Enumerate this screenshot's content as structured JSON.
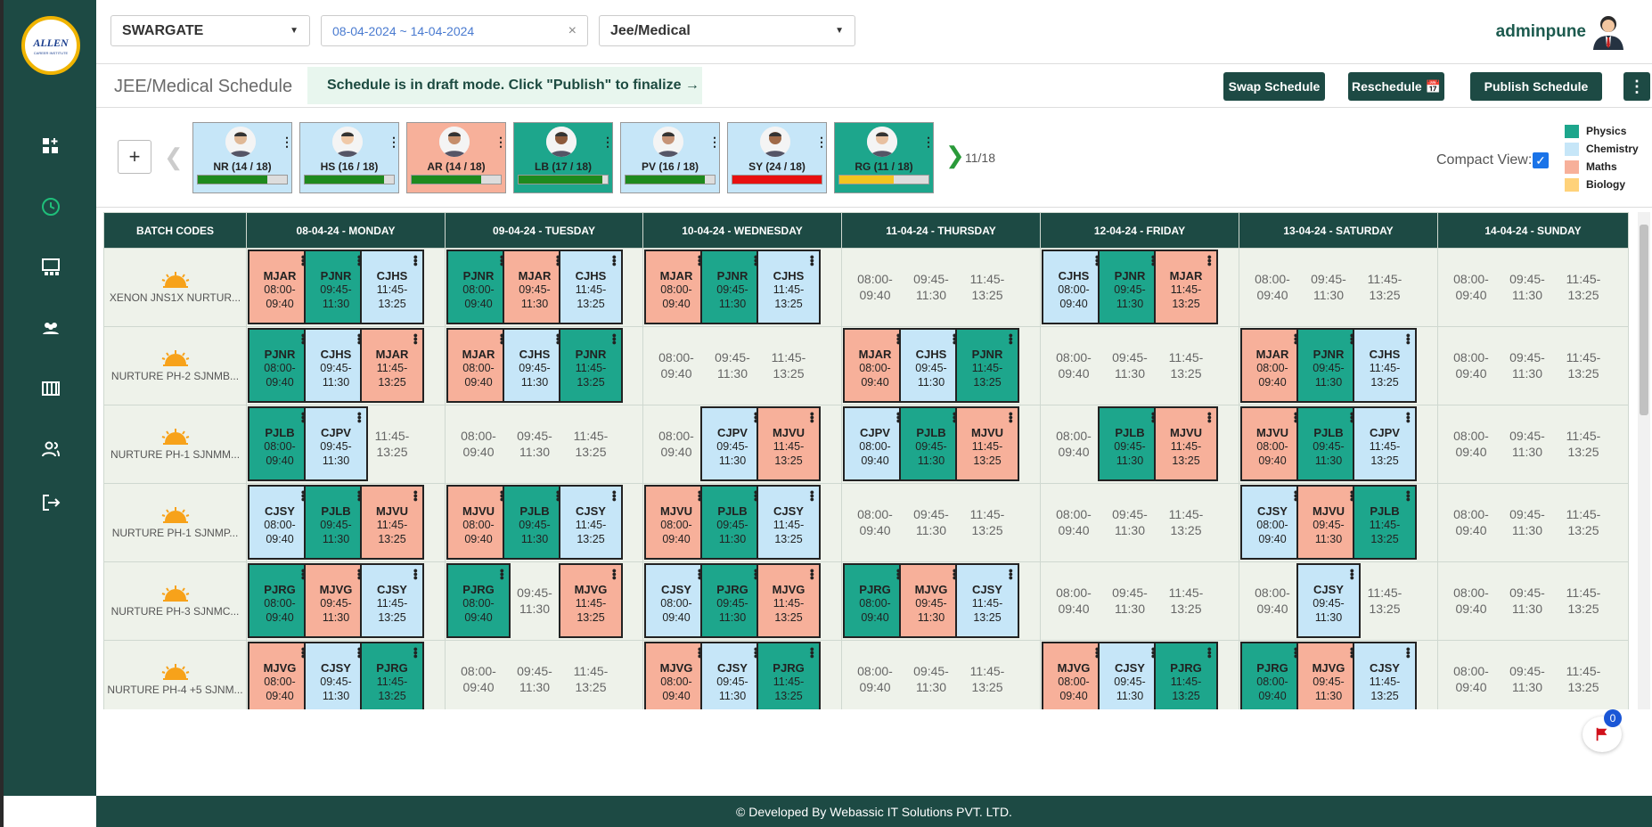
{
  "header": {
    "center": "SWARGATE",
    "date_range": "08-04-2024 ~ 14-04-2024",
    "course": "Jee/Medical",
    "user": "adminpune"
  },
  "subheader": {
    "title": "JEE/Medical Schedule",
    "draft_notice": "Schedule is in draft mode. Click \"Publish\" to finalize →",
    "swap_label": "Swap Schedule",
    "reschedule_label": "Reschedule 📅",
    "publish_label": "Publish Schedule"
  },
  "teachers": [
    {
      "code": "NR",
      "label": "NR  (14 / 18)",
      "subject": "chemistry",
      "progress": 0.78,
      "bar_color": "#1e8a1e"
    },
    {
      "code": "HS",
      "label": "HS  (16 / 18)",
      "subject": "chemistry",
      "progress": 0.89,
      "bar_color": "#1e8a1e"
    },
    {
      "code": "AR",
      "label": "AR  (14 / 18)",
      "subject": "maths",
      "progress": 0.78,
      "bar_color": "#1e8a1e"
    },
    {
      "code": "LB",
      "label": "LB  (17 / 18)",
      "subject": "physics",
      "progress": 0.94,
      "bar_color": "#1e8a1e"
    },
    {
      "code": "PV",
      "label": "PV  (16 / 18)",
      "subject": "chemistry",
      "progress": 0.89,
      "bar_color": "#1e8a1e"
    },
    {
      "code": "SY",
      "label": "SY  (24 / 18)",
      "subject": "chemistry",
      "progress": 1.0,
      "bar_color": "#e81010"
    },
    {
      "code": "RG",
      "label": "RG  (11 / 18)",
      "subject": "physics",
      "progress": 0.61,
      "bar_color": "#f2c420"
    }
  ],
  "pager": "11/18",
  "compact_view_label": "Compact View:",
  "legend": [
    {
      "label": "Physics",
      "color": "#1da68c"
    },
    {
      "label": "Chemistry",
      "color": "#c6e6f8"
    },
    {
      "label": "Maths",
      "color": "#f7b09a"
    },
    {
      "label": "Biology",
      "color": "#ffd27a"
    }
  ],
  "batch_header": "BATCH CODES",
  "days": [
    "08-04-24 - MONDAY",
    "09-04-24 - TUESDAY",
    "10-04-24 - WEDNESDAY",
    "11-04-24 - THURSDAY",
    "12-04-24 - FRIDAY",
    "13-04-24 - SATURDAY",
    "14-04-24 - SUNDAY"
  ],
  "slot_times": [
    [
      "08:00-",
      "09:40"
    ],
    [
      "09:45-",
      "11:30"
    ],
    [
      "11:45-",
      "13:25"
    ]
  ],
  "rows": [
    {
      "batch": "XENON JNS1X NURTUR...",
      "days": [
        [
          {
            "c": "MJAR",
            "s": "ma"
          },
          {
            "c": "PJNR",
            "s": "ph"
          },
          {
            "c": "CJHS",
            "s": "ch"
          }
        ],
        [
          {
            "c": "PJNR",
            "s": "ph"
          },
          {
            "c": "MJAR",
            "s": "ma"
          },
          {
            "c": "CJHS",
            "s": "ch"
          }
        ],
        [
          {
            "c": "MJAR",
            "s": "ma"
          },
          {
            "c": "PJNR",
            "s": "ph"
          },
          {
            "c": "CJHS",
            "s": "ch"
          }
        ],
        [
          null,
          null,
          null
        ],
        [
          {
            "c": "CJHS",
            "s": "ch"
          },
          {
            "c": "PJNR",
            "s": "ph"
          },
          {
            "c": "MJAR",
            "s": "ma"
          }
        ],
        [
          null,
          null,
          null
        ],
        [
          null,
          null,
          null
        ]
      ]
    },
    {
      "batch": "NURTURE PH-2 SJNMB...",
      "days": [
        [
          {
            "c": "PJNR",
            "s": "ph"
          },
          {
            "c": "CJHS",
            "s": "ch"
          },
          {
            "c": "MJAR",
            "s": "ma"
          }
        ],
        [
          {
            "c": "MJAR",
            "s": "ma"
          },
          {
            "c": "CJHS",
            "s": "ch"
          },
          {
            "c": "PJNR",
            "s": "ph"
          }
        ],
        [
          null,
          null,
          null
        ],
        [
          {
            "c": "MJAR",
            "s": "ma"
          },
          {
            "c": "CJHS",
            "s": "ch"
          },
          {
            "c": "PJNR",
            "s": "ph"
          }
        ],
        [
          null,
          null,
          null
        ],
        [
          {
            "c": "MJAR",
            "s": "ma"
          },
          {
            "c": "PJNR",
            "s": "ph"
          },
          {
            "c": "CJHS",
            "s": "ch"
          }
        ],
        [
          null,
          null,
          null
        ]
      ]
    },
    {
      "batch": "NURTURE PH-1 SJNMM...",
      "days": [
        [
          {
            "c": "PJLB",
            "s": "ph"
          },
          {
            "c": "CJPV",
            "s": "ch"
          },
          null
        ],
        [
          null,
          null,
          null
        ],
        [
          null,
          {
            "c": "CJPV",
            "s": "ch"
          },
          {
            "c": "MJVU",
            "s": "ma"
          }
        ],
        [
          {
            "c": "CJPV",
            "s": "ch"
          },
          {
            "c": "PJLB",
            "s": "ph"
          },
          {
            "c": "MJVU",
            "s": "ma"
          }
        ],
        [
          null,
          {
            "c": "PJLB",
            "s": "ph"
          },
          {
            "c": "MJVU",
            "s": "ma"
          }
        ],
        [
          {
            "c": "MJVU",
            "s": "ma"
          },
          {
            "c": "PJLB",
            "s": "ph"
          },
          {
            "c": "CJPV",
            "s": "ch"
          }
        ],
        [
          null,
          null,
          null
        ]
      ]
    },
    {
      "batch": "NURTURE PH-1 SJNMP...",
      "days": [
        [
          {
            "c": "CJSY",
            "s": "ch"
          },
          {
            "c": "PJLB",
            "s": "ph"
          },
          {
            "c": "MJVU",
            "s": "ma"
          }
        ],
        [
          {
            "c": "MJVU",
            "s": "ma"
          },
          {
            "c": "PJLB",
            "s": "ph"
          },
          {
            "c": "CJSY",
            "s": "ch"
          }
        ],
        [
          {
            "c": "MJVU",
            "s": "ma"
          },
          {
            "c": "PJLB",
            "s": "ph"
          },
          {
            "c": "CJSY",
            "s": "ch"
          }
        ],
        [
          null,
          null,
          null
        ],
        [
          null,
          null,
          null
        ],
        [
          {
            "c": "CJSY",
            "s": "ch"
          },
          {
            "c": "MJVU",
            "s": "ma"
          },
          {
            "c": "PJLB",
            "s": "ph"
          }
        ],
        [
          null,
          null,
          null
        ]
      ]
    },
    {
      "batch": "NURTURE PH-3 SJNMC...",
      "days": [
        [
          {
            "c": "PJRG",
            "s": "ph"
          },
          {
            "c": "MJVG",
            "s": "ma"
          },
          {
            "c": "CJSY",
            "s": "ch"
          }
        ],
        [
          {
            "c": "PJRG",
            "s": "ph"
          },
          null,
          {
            "c": "MJVG",
            "s": "ma"
          }
        ],
        [
          {
            "c": "CJSY",
            "s": "ch"
          },
          {
            "c": "PJRG",
            "s": "ph"
          },
          {
            "c": "MJVG",
            "s": "ma"
          }
        ],
        [
          {
            "c": "PJRG",
            "s": "ph"
          },
          {
            "c": "MJVG",
            "s": "ma"
          },
          {
            "c": "CJSY",
            "s": "ch"
          }
        ],
        [
          null,
          null,
          null
        ],
        [
          null,
          {
            "c": "CJSY",
            "s": "ch"
          },
          null
        ],
        [
          null,
          null,
          null
        ]
      ]
    },
    {
      "batch": "NURTURE PH-4 +5 SJNM...",
      "days": [
        [
          {
            "c": "MJVG",
            "s": "ma"
          },
          {
            "c": "CJSY",
            "s": "ch"
          },
          {
            "c": "PJRG",
            "s": "ph"
          }
        ],
        [
          null,
          null,
          null
        ],
        [
          {
            "c": "MJVG",
            "s": "ma"
          },
          {
            "c": "CJSY",
            "s": "ch"
          },
          {
            "c": "PJRG",
            "s": "ph"
          }
        ],
        [
          null,
          null,
          null
        ],
        [
          {
            "c": "MJVG",
            "s": "ma"
          },
          {
            "c": "CJSY",
            "s": "ch"
          },
          {
            "c": "PJRG",
            "s": "ph"
          }
        ],
        [
          {
            "c": "PJRG",
            "s": "ph"
          },
          {
            "c": "MJVG",
            "s": "ma"
          },
          {
            "c": "CJSY",
            "s": "ch"
          }
        ],
        [
          null,
          null,
          null
        ]
      ]
    }
  ],
  "notifications": "0",
  "footer": "© Developed By Webassic IT Solutions PVT. LTD."
}
